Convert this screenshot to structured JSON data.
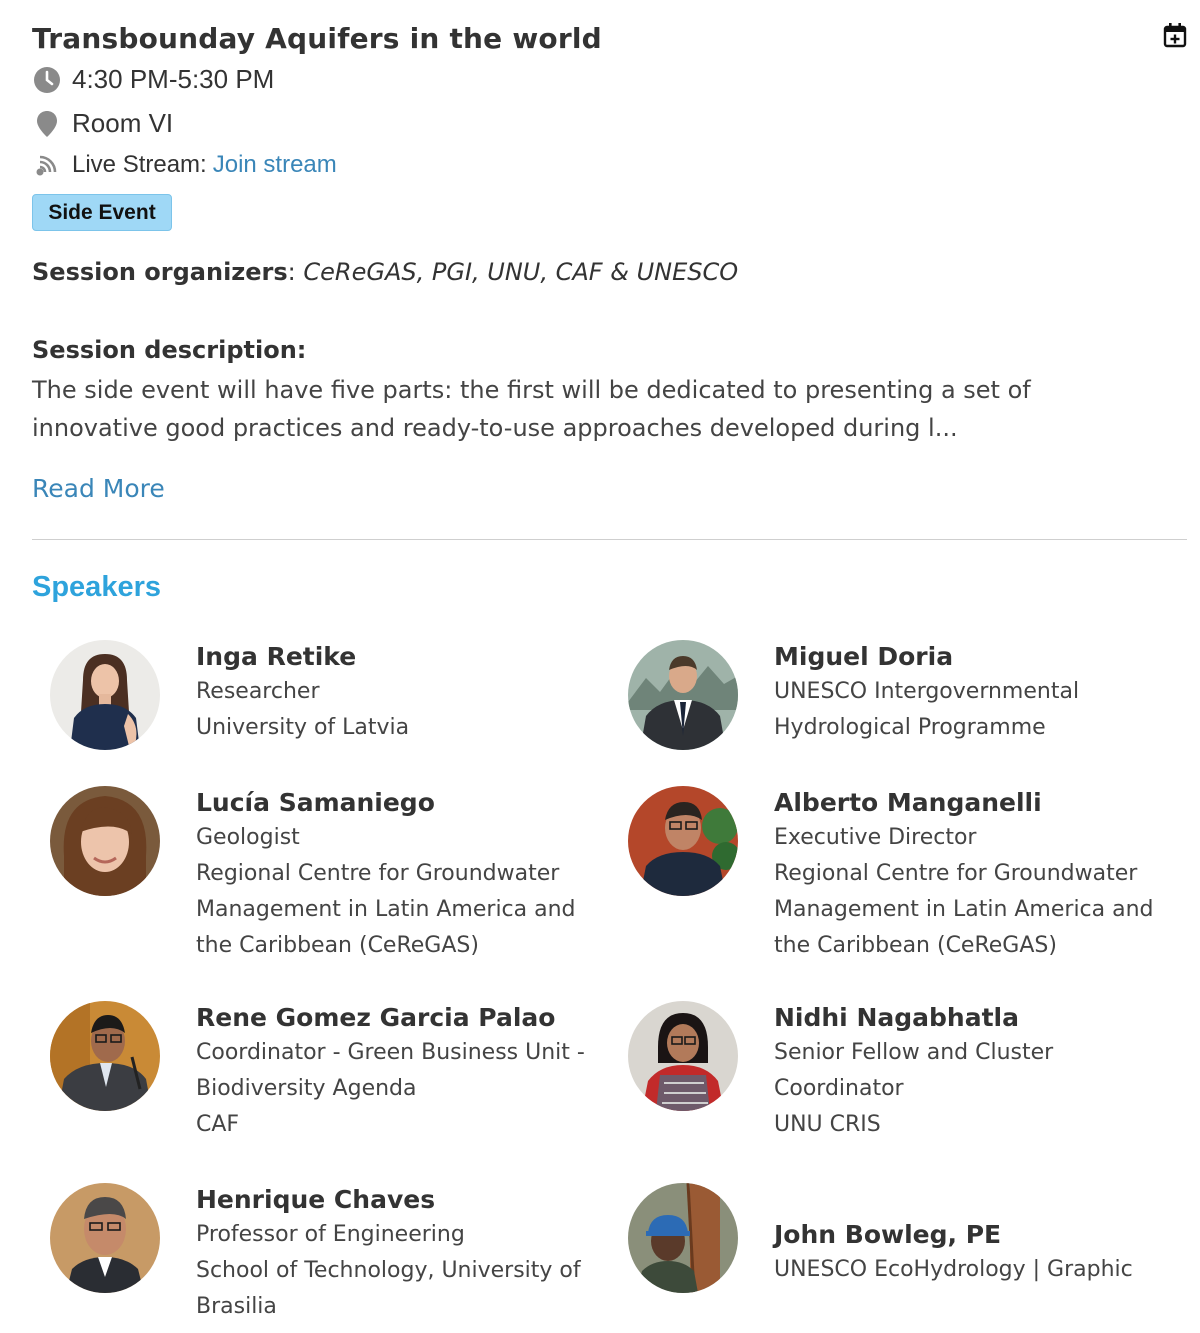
{
  "event": {
    "title": "Transbounday Aquifers in the world",
    "time": "4:30 PM-5:30 PM",
    "room": "Room VI",
    "stream_label": "Live Stream:",
    "stream_link": "Join stream",
    "badge": "Side Event",
    "organizers_label": "Session organizers",
    "organizers_sep": ":",
    "organizers_value": "CeReGAS, PGI, UNU, CAF & UNESCO",
    "description_label": "Session description:",
    "description": "The side event will have five parts: the first will be dedicated to presenting a set of innovative good practices and ready-to-use approaches developed during l...",
    "read_more": "Read More"
  },
  "speakers_heading": "Speakers",
  "speakers": [
    {
      "name": "Inga Retike",
      "lines": [
        "Researcher",
        "University of Latvia"
      ]
    },
    {
      "name": "Miguel Doria",
      "lines": [
        "UNESCO Intergovernmental",
        "Hydrological Programme"
      ]
    },
    {
      "name": "Lucía Samaniego",
      "lines": [
        "Geologist",
        "Regional Centre for Groundwater",
        "Management in Latin America and",
        "the Caribbean (CeReGAS)"
      ]
    },
    {
      "name": "Alberto Manganelli",
      "lines": [
        "Executive Director",
        "Regional Centre for Groundwater",
        "Management in Latin America and",
        "the Caribbean (CeReGAS)"
      ]
    },
    {
      "name": "Rene Gomez Garcia Palao",
      "lines": [
        "Coordinator - Green Business Unit -",
        "Biodiversity Agenda",
        "CAF"
      ]
    },
    {
      "name": "Nidhi Nagabhatla",
      "lines": [
        "Senior Fellow and Cluster",
        "Coordinator",
        "UNU CRIS"
      ]
    },
    {
      "name": "Henrique Chaves",
      "lines": [
        "Professor of Engineering",
        "School of Technology, University of",
        "Brasilia"
      ]
    },
    {
      "name": "John Bowleg, PE",
      "lines": [
        "UNESCO EcoHydrology | Graphic"
      ]
    }
  ],
  "colors": {
    "link": "#3a86b8",
    "heading_accent": "#2ea3dc",
    "badge_bg": "#9fd8f6"
  },
  "icons": [
    "clock-icon",
    "location-pin-icon",
    "live-stream-icon",
    "calendar-add-icon"
  ]
}
